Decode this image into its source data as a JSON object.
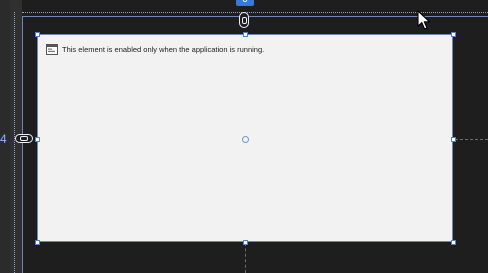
{
  "guides": {
    "top_label": "0",
    "left_label": "4"
  },
  "element": {
    "message": "This element is enabled only when the application is running.",
    "icon": "form-window-icon"
  },
  "cursor": {
    "icon": "mouse-pointer-icon"
  },
  "colors": {
    "canvas": "#1e1e1e",
    "element_bg": "#f2f2f2",
    "selection": "#6f86b6",
    "accent": "#3a78d8"
  }
}
